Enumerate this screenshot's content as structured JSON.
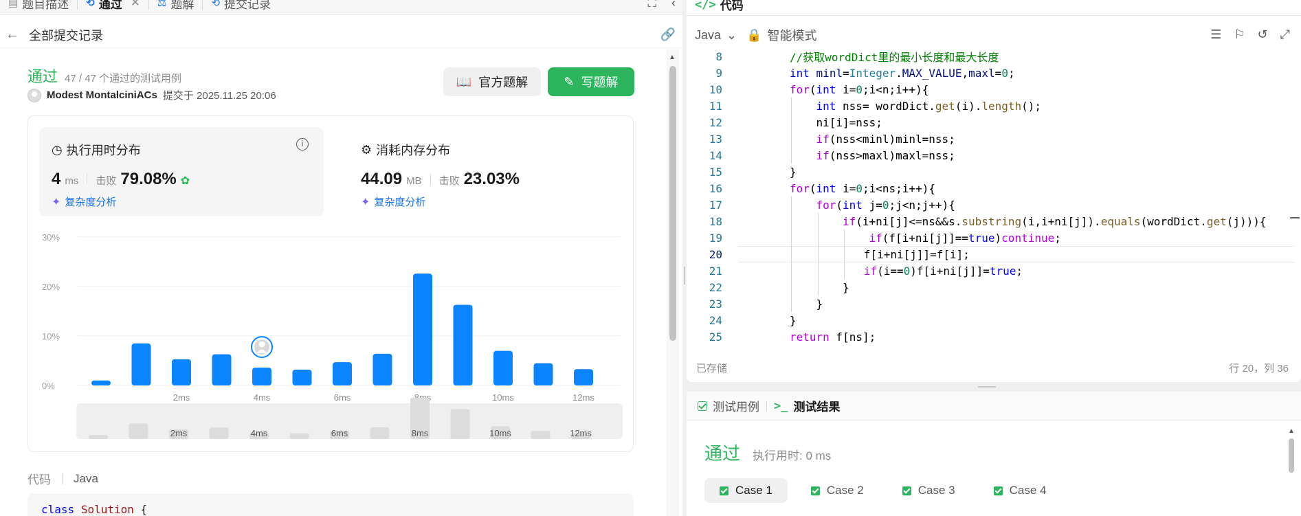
{
  "tabs": [
    {
      "label": "题目描述",
      "icon": "document-icon"
    },
    {
      "label": "通过",
      "icon": "history-icon"
    },
    {
      "label": "题解",
      "icon": "flask-icon"
    },
    {
      "label": "提交记录",
      "icon": "history-icon"
    }
  ],
  "subheader": {
    "title": "全部提交记录"
  },
  "submission": {
    "status": "通过",
    "testcases": "47 / 47 个通过的测试用例",
    "author": "Modest MontalciniACs",
    "submitted_at": "提交于 2025.11.25 20:06",
    "btn_official": "官方题解",
    "btn_write": "写题解"
  },
  "runtime": {
    "title": "执行用时分布",
    "value": "4",
    "unit": "ms",
    "beats_label": "击败",
    "beats": "79.08%",
    "complexity": "复杂度分析"
  },
  "memory": {
    "title": "消耗内存分布",
    "value": "44.09",
    "unit": "MB",
    "beats_label": "击败",
    "beats": "23.03%",
    "complexity": "复杂度分析"
  },
  "chart_data": {
    "type": "bar",
    "title": "",
    "xlabel": "",
    "ylabel": "",
    "y_ticks": [
      "0%",
      "10%",
      "20%",
      "30%"
    ],
    "ylim": [
      0,
      30
    ],
    "x_ticks": [
      "2ms",
      "4ms",
      "6ms",
      "8ms",
      "10ms",
      "12ms"
    ],
    "values": [
      1.0,
      8.5,
      5.3,
      6.3,
      3.6,
      3.2,
      4.7,
      6.4,
      22.6,
      16.3,
      7.0,
      4.5,
      3.3
    ],
    "highlight_index": 4,
    "grid": true,
    "minimap_ticks": [
      "2ms",
      "4ms",
      "6ms",
      "8ms",
      "10ms",
      "12ms"
    ]
  },
  "code_section": {
    "label": "代码",
    "lang": "Java",
    "first_line_kw": "class",
    "first_line_cls": "Solution",
    "first_line_brace": "{"
  },
  "editor": {
    "tab": "代码",
    "lang": "Java",
    "mode": "智能模式",
    "saved": "已存储",
    "cursor": "行 20，列 36",
    "current_line": 20,
    "lines": [
      {
        "n": 8,
        "indent": 2,
        "segs": [
          [
            "c-com",
            "//获取wordDict里的最小长度和最大长度"
          ]
        ]
      },
      {
        "n": 9,
        "indent": 2,
        "segs": [
          [
            "c-kw",
            "int"
          ],
          [
            "",
            " "
          ],
          [
            "c-var",
            "minl"
          ],
          [
            "",
            "="
          ],
          [
            "c-cls",
            "Integer"
          ],
          [
            "",
            "."
          ],
          [
            "c-var",
            "MAX_VALUE"
          ],
          [
            "",
            ","
          ],
          [
            "c-var",
            "maxl"
          ],
          [
            "",
            "="
          ],
          [
            "c-num",
            "0"
          ],
          [
            "",
            ";"
          ]
        ]
      },
      {
        "n": 10,
        "indent": 2,
        "segs": [
          [
            "c-ctl",
            "for"
          ],
          [
            "",
            "("
          ],
          [
            "c-kw",
            "int"
          ],
          [
            "",
            " i="
          ],
          [
            "c-num",
            "0"
          ],
          [
            "",
            ";i<n;i++){"
          ]
        ]
      },
      {
        "n": 11,
        "indent": 3,
        "segs": [
          [
            "c-kw",
            "int"
          ],
          [
            "",
            " nss= wordDict."
          ],
          [
            "c-fn",
            "get"
          ],
          [
            "",
            "(i)."
          ],
          [
            "c-fn",
            "length"
          ],
          [
            "",
            "();"
          ]
        ]
      },
      {
        "n": 12,
        "indent": 3,
        "segs": [
          [
            "",
            "ni[i]=nss;"
          ]
        ]
      },
      {
        "n": 13,
        "indent": 3,
        "segs": [
          [
            "c-ctl",
            "if"
          ],
          [
            "",
            "(nss<minl)minl=nss;"
          ]
        ]
      },
      {
        "n": 14,
        "indent": 3,
        "segs": [
          [
            "c-ctl",
            "if"
          ],
          [
            "",
            "(nss>maxl)maxl=nss;"
          ]
        ]
      },
      {
        "n": 15,
        "indent": 2,
        "segs": [
          [
            "",
            "}"
          ]
        ]
      },
      {
        "n": 16,
        "indent": 2,
        "segs": [
          [
            "c-ctl",
            "for"
          ],
          [
            "",
            "("
          ],
          [
            "c-kw",
            "int"
          ],
          [
            "",
            " i="
          ],
          [
            "c-num",
            "0"
          ],
          [
            "",
            ";i<ns;i++){"
          ]
        ]
      },
      {
        "n": 17,
        "indent": 3,
        "segs": [
          [
            "c-ctl",
            "for"
          ],
          [
            "",
            "("
          ],
          [
            "c-kw",
            "int"
          ],
          [
            "",
            " j="
          ],
          [
            "c-num",
            "0"
          ],
          [
            "",
            ";j<n;j++){"
          ]
        ]
      },
      {
        "n": 18,
        "indent": 4,
        "segs": [
          [
            "c-ctl",
            "if"
          ],
          [
            "",
            "(i+ni[j]<=ns&&s."
          ],
          [
            "c-fn",
            "substring"
          ],
          [
            "",
            "(i,i+ni[j])."
          ],
          [
            "c-fn",
            "equals"
          ],
          [
            "",
            "(wordDict."
          ],
          [
            "c-fn",
            "get"
          ],
          [
            "",
            "(j))){"
          ]
        ]
      },
      {
        "n": 19,
        "indent": 5,
        "segs": [
          [
            "c-ctl",
            "if"
          ],
          [
            "",
            "(f[i+ni[j]]=="
          ],
          [
            "c-kw",
            "true"
          ],
          [
            "",
            ")"
          ],
          [
            "c-ctl",
            "continue"
          ],
          [
            "",
            ";"
          ]
        ]
      },
      {
        "n": 20,
        "indent": 4.8,
        "segs": [
          [
            "",
            "f[i+ni[j]]=f[i];"
          ]
        ]
      },
      {
        "n": 21,
        "indent": 4.8,
        "segs": [
          [
            "c-ctl",
            "if"
          ],
          [
            "",
            "(i=="
          ],
          [
            "c-num",
            "0"
          ],
          [
            "",
            ")f[i+ni[j]]="
          ],
          [
            "c-kw",
            "true"
          ],
          [
            "",
            ";"
          ]
        ]
      },
      {
        "n": 22,
        "indent": 4,
        "segs": [
          [
            "",
            "}"
          ]
        ]
      },
      {
        "n": 23,
        "indent": 3,
        "segs": [
          [
            "",
            "}"
          ]
        ]
      },
      {
        "n": 24,
        "indent": 2,
        "segs": [
          [
            "",
            "}"
          ]
        ]
      },
      {
        "n": 25,
        "indent": 2,
        "segs": [
          [
            "c-ctl",
            "return"
          ],
          [
            "",
            " f[ns];"
          ]
        ]
      }
    ]
  },
  "tests": {
    "tab_cases": "测试用例",
    "tab_result": "测试结果",
    "status": "通过",
    "runtime": "执行用时: 0 ms",
    "cases": [
      "Case 1",
      "Case 2",
      "Case 3",
      "Case 4"
    ]
  }
}
